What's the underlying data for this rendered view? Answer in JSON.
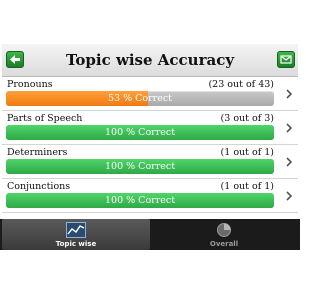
{
  "header": {
    "title": "Topic wise Accuracy",
    "left_icon": "back-arrow-icon",
    "right_icon": "mail-icon"
  },
  "rows": [
    {
      "topic": "Pronouns",
      "count": "(23 out of 43)",
      "label": "53 % Correct",
      "percent": 53,
      "color": "#f5841f"
    },
    {
      "topic": "Parts of Speech",
      "count": "(3 out of 3)",
      "label": "100 % Correct",
      "percent": 100,
      "color": "#3cc152"
    },
    {
      "topic": "Determiners",
      "count": "(1 out of 1)",
      "label": "100 % Correct",
      "percent": 100,
      "color": "#3cc152"
    },
    {
      "topic": "Conjunctions",
      "count": "(1 out of 1)",
      "label": "100 % Correct",
      "percent": 100,
      "color": "#3cc152"
    }
  ],
  "tabs": [
    {
      "label": "Topic wise",
      "icon": "line-chart-icon",
      "active": true
    },
    {
      "label": "Overall",
      "icon": "pie-chart-icon",
      "active": false
    }
  ]
}
